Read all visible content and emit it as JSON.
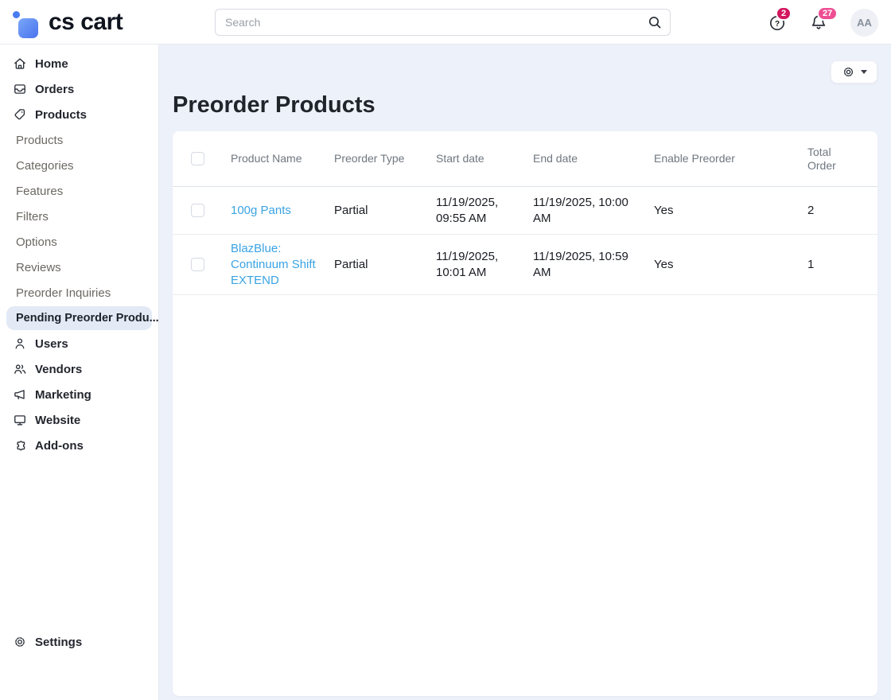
{
  "topbar": {
    "logo_text": "cs cart",
    "search": {
      "placeholder": "Search"
    },
    "help": {
      "badge": "2"
    },
    "notifications": {
      "badge": "27"
    },
    "avatar": {
      "initials": "AA"
    }
  },
  "sidebar": {
    "items": [
      {
        "label": "Home"
      },
      {
        "label": "Orders"
      },
      {
        "label": "Products"
      },
      {
        "label": "Products"
      },
      {
        "label": "Categories"
      },
      {
        "label": "Features"
      },
      {
        "label": "Filters"
      },
      {
        "label": "Options"
      },
      {
        "label": "Reviews"
      },
      {
        "label": "Preorder Inquiries"
      },
      {
        "label": "Pending Preorder Produ..."
      },
      {
        "label": "Users"
      },
      {
        "label": "Vendors"
      },
      {
        "label": "Marketing"
      },
      {
        "label": "Website"
      },
      {
        "label": "Add-ons"
      }
    ],
    "settings_label": "Settings"
  },
  "main": {
    "title": "Preorder Products",
    "table": {
      "columns": [
        "Product Name",
        "Preorder Type",
        "Start date",
        "End date",
        "Enable Preorder",
        "Total Order"
      ],
      "rows": [
        {
          "product_name": "100g Pants",
          "preorder_type": "Partial",
          "start_date": "11/19/2025, 09:55 AM",
          "end_date": "11/19/2025, 10:00 AM",
          "enable_preorder": "Yes",
          "total_order": "2"
        },
        {
          "product_name": "BlazBlue: Continuum Shift EXTEND",
          "preorder_type": "Partial",
          "start_date": "11/19/2025, 10:01 AM",
          "end_date": "11/19/2025, 10:59 AM",
          "enable_preorder": "Yes",
          "total_order": "1"
        }
      ]
    }
  },
  "colors": {
    "link_blue": "#3aa3e3",
    "active_item_bg": "#e3eaf6",
    "badge_help": "#d3175f",
    "badge_notifications": "#ee4f93",
    "logo_blue_light": "#7aa7f8",
    "logo_blue_dark": "#4a72ee",
    "content_bg": "#edf1fa"
  }
}
